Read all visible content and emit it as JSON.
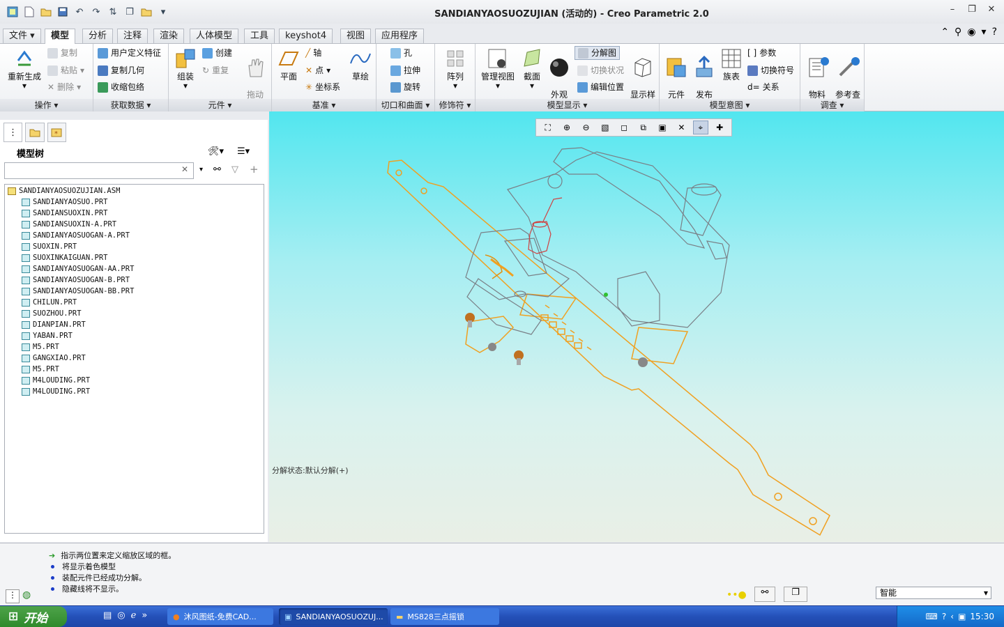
{
  "window": {
    "title": "SANDIANYAOSUOZUJIAN (活动的) - Creo Parametric 2.0"
  },
  "tabs": [
    "文件 ▾",
    "模型",
    "分析",
    "注释",
    "渲染",
    "人体模型",
    "工具",
    "keyshot4",
    "视图",
    "应用程序"
  ],
  "ribbon": {
    "operations": {
      "label": "操作 ▾",
      "regen": "重新生成",
      "copy": "复制",
      "paste": "粘贴",
      "delete": "删除"
    },
    "getdata": {
      "label": "获取数据 ▾",
      "udf": "用户定义特征",
      "copygeom": "复制几何",
      "shrinkwrap": "收缩包络"
    },
    "component": {
      "label": "元件 ▾",
      "assemble": "组装",
      "create": "创建",
      "repeat": "重复",
      "drag": "拖动\n元件"
    },
    "datum": {
      "label": "基准 ▾",
      "plane": "平面",
      "axis": "轴",
      "point": "点",
      "csys": "坐标系",
      "sketch": "草绘"
    },
    "cut": {
      "label": "切口和曲面 ▾",
      "hole": "孔",
      "extrude": "拉伸",
      "revolve": "旋转"
    },
    "modifiers": {
      "label": "修饰符 ▾",
      "pattern": "阵列"
    },
    "display": {
      "label": "模型显示 ▾",
      "views": "管理视图",
      "section": "截面",
      "appearance": "外观\n库",
      "explode": "分解图",
      "toggle": "切换状况",
      "editpos": "编辑位置",
      "style": "显示样\n式"
    },
    "intent": {
      "label": "模型意图 ▾",
      "interface": "元件\n界面",
      "publish": "发布\n几何",
      "family": "族表",
      "params": "参数",
      "switchsym": "切换符号",
      "relations": "关系"
    },
    "investigate": {
      "label": "调查 ▾",
      "bom": "物料\n清单",
      "refviewer": "参考查\n看器"
    }
  },
  "tree": {
    "title": "模型树",
    "root": "SANDIANYAOSUOZUJIAN.ASM",
    "items": [
      "SANDIANYAOSUO.PRT",
      "SANDIANSUOXIN.PRT",
      "SANDIANSUOXIN-A.PRT",
      "SANDIANYAOSUOGAN-A.PRT",
      "SUOXIN.PRT",
      "SUOXINKAIGUAN.PRT",
      "SANDIANYAOSUOGAN-AA.PRT",
      "SANDIANYAOSUOGAN-B.PRT",
      "SANDIANYAOSUOGAN-BB.PRT",
      "CHILUN.PRT",
      "SUOZHOU.PRT",
      "DIANPIAN.PRT",
      "YABAN.PRT",
      "M5.PRT",
      "GANGXIAO.PRT",
      "M5.PRT",
      "M4LOUDING.PRT",
      "M4LOUDING.PRT"
    ]
  },
  "viewport": {
    "explode_status": "分解状态:默认分解(+)"
  },
  "messages": [
    "指示两位置来定义缩放区域的框。",
    "将显示着色模型",
    "装配元件已经成功分解。",
    "隐藏线将不显示。"
  ],
  "statusbar": {
    "filter": "智能"
  },
  "taskbar": {
    "start": "开始",
    "tasks": [
      "沐风图纸-免费CAD...",
      "SANDIANYAOSUOZUJ...",
      "MS828三点摇锁"
    ],
    "time": "15:30"
  },
  "colors": {
    "orange": "#f0a020",
    "gray": "#7a7f86",
    "viewport_top": "#52e6ef"
  }
}
